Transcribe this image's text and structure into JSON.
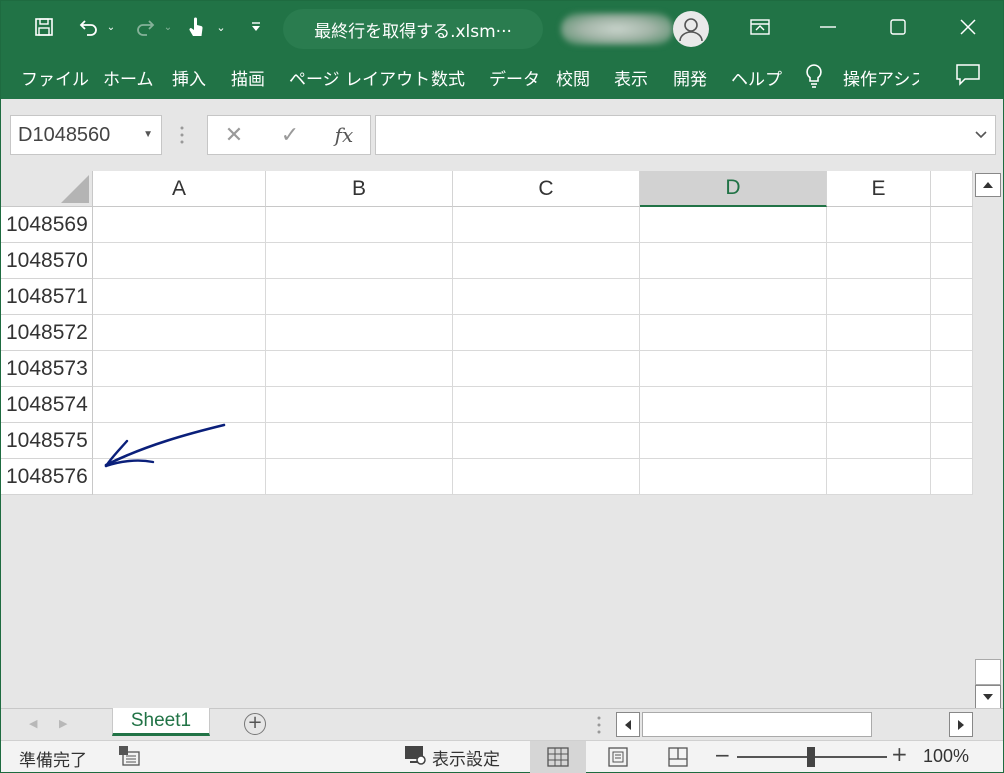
{
  "titlebar": {
    "document_title": "最終行を取得する.xlsm···",
    "qat_icons": [
      "save-icon",
      "undo-icon",
      "redo-icon",
      "touch-mode-icon",
      "customize-qat-icon"
    ],
    "window_controls": [
      "ribbon-display-icon",
      "minimize-icon",
      "maximize-icon",
      "close-icon"
    ]
  },
  "ribbon": {
    "tabs": [
      {
        "label": "ファイル"
      },
      {
        "label": "ホーム"
      },
      {
        "label": "挿入"
      },
      {
        "label": "描画"
      },
      {
        "label": "ページ レイアウト"
      },
      {
        "label": "数式"
      },
      {
        "label": "データ"
      },
      {
        "label": "校閲"
      },
      {
        "label": "表示"
      },
      {
        "label": "開発"
      },
      {
        "label": "ヘルプ"
      },
      {
        "label": "操作アシス"
      }
    ]
  },
  "formula_bar": {
    "name_box": "D1048560",
    "cancel_symbol": "✕",
    "enter_symbol": "✓",
    "fx_label": "fx",
    "formula_value": ""
  },
  "grid": {
    "columns": [
      "A",
      "B",
      "C",
      "D",
      "E"
    ],
    "selected_column": "D",
    "rows": [
      "1048569",
      "1048570",
      "1048571",
      "1048572",
      "1048573",
      "1048574",
      "1048575",
      "1048576"
    ],
    "annotation_color": "#0a1f7a"
  },
  "sheets": {
    "tabs": [
      {
        "label": "Sheet1",
        "active": true
      }
    ],
    "add_label": "+"
  },
  "statusbar": {
    "status": "準備完了",
    "display_settings": "表示設定",
    "zoom_level": "100%",
    "zoom_minus": "−",
    "zoom_plus": "+"
  },
  "colors": {
    "brand": "#217346",
    "selection": "#217346"
  }
}
